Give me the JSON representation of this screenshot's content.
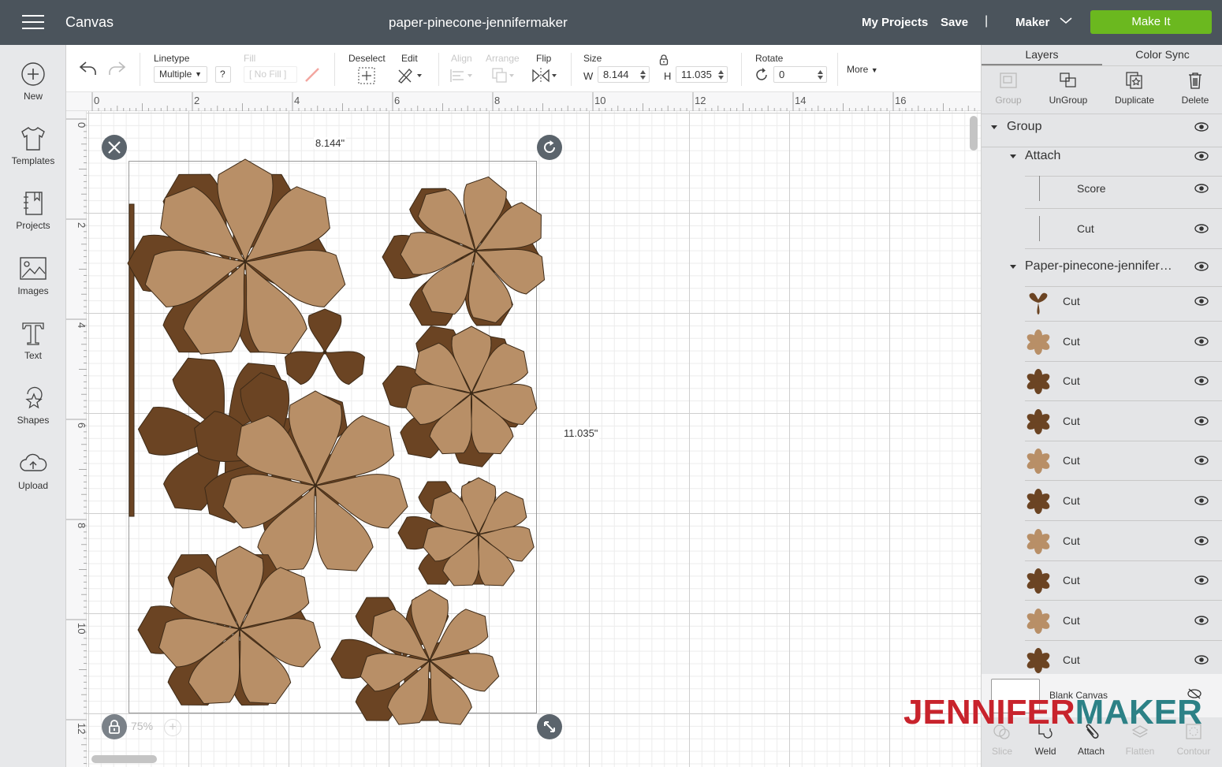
{
  "topbar": {
    "app_name": "Canvas",
    "project_title": "paper-pinecone-jennifermaker",
    "my_projects": "My Projects",
    "save": "Save",
    "separator": "|",
    "machine": "Maker",
    "make_it": "Make It",
    "make_it_color": "#6bb81f"
  },
  "leftnav": {
    "items": [
      {
        "label": "New",
        "icon": "plus-circle-icon"
      },
      {
        "label": "Templates",
        "icon": "tshirt-icon"
      },
      {
        "label": "Projects",
        "icon": "notebook-icon"
      },
      {
        "label": "Images",
        "icon": "image-icon"
      },
      {
        "label": "Text",
        "icon": "text-icon"
      },
      {
        "label": "Shapes",
        "icon": "shapes-icon"
      },
      {
        "label": "Upload",
        "icon": "cloud-upload-icon"
      }
    ]
  },
  "toolbar": {
    "linetype_label": "Linetype",
    "linetype_value": "Multiple",
    "help": "?",
    "fill_label": "Fill",
    "fill_value": "[ No Fill ]",
    "deselect_label": "Deselect",
    "edit_label": "Edit",
    "align_label": "Align",
    "arrange_label": "Arrange",
    "flip_label": "Flip",
    "size_label": "Size",
    "w_label": "W",
    "w_value": "8.144",
    "h_label": "H",
    "h_value": "11.035",
    "rotate_label": "Rotate",
    "rotate_value": "0",
    "more_label": "More"
  },
  "rulers": {
    "horizontal": [
      "0",
      "2",
      "4",
      "6",
      "8",
      "10",
      "12",
      "14",
      "16"
    ],
    "vertical": [
      "0",
      "2",
      "4",
      "6",
      "8",
      "10",
      "12"
    ]
  },
  "canvas": {
    "width_label": "8.144\"",
    "height_label": "11.035\"",
    "zoom": "75%",
    "dark_color": "#6b4423",
    "light_color": "#b88f67"
  },
  "panel": {
    "tabs": [
      "Layers",
      "Color Sync"
    ],
    "tools": [
      {
        "label": "Group",
        "disabled": true
      },
      {
        "label": "UnGroup",
        "disabled": false
      },
      {
        "label": "Duplicate",
        "disabled": false
      },
      {
        "label": "Delete",
        "disabled": false
      }
    ],
    "layers": {
      "group": "Group",
      "attach": "Attach",
      "score": "Score",
      "attach_cut": "Cut",
      "image_group": "Paper-pinecone-jennifer…",
      "cuts": [
        {
          "label": "Cut",
          "shape": "trefoil",
          "tone": "dark"
        },
        {
          "label": "Cut",
          "shape": "flower",
          "tone": "light"
        },
        {
          "label": "Cut",
          "shape": "flower",
          "tone": "dark"
        },
        {
          "label": "Cut",
          "shape": "flower",
          "tone": "dark"
        },
        {
          "label": "Cut",
          "shape": "flower",
          "tone": "light"
        },
        {
          "label": "Cut",
          "shape": "flower",
          "tone": "dark"
        },
        {
          "label": "Cut",
          "shape": "flower",
          "tone": "light"
        },
        {
          "label": "Cut",
          "shape": "flower",
          "tone": "dark"
        },
        {
          "label": "Cut",
          "shape": "flower",
          "tone": "light"
        },
        {
          "label": "Cut",
          "shape": "flower",
          "tone": "dark"
        }
      ]
    },
    "blank_canvas": "Blank Canvas",
    "bottom_tools": [
      {
        "label": "Slice",
        "disabled": true
      },
      {
        "label": "Weld",
        "disabled": false
      },
      {
        "label": "Attach",
        "disabled": false
      },
      {
        "label": "Flatten",
        "disabled": true
      },
      {
        "label": "Contour",
        "disabled": true
      }
    ]
  },
  "watermark": {
    "part1": "JENNIFER",
    "part2": "MAKER"
  }
}
